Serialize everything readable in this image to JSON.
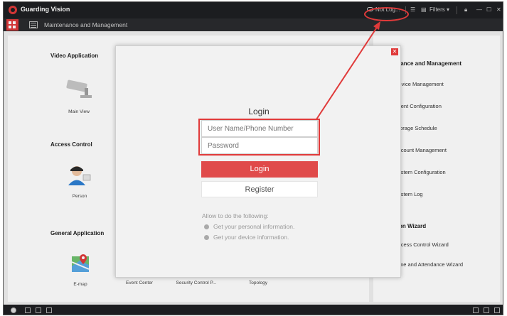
{
  "titlebar": {
    "app_title": "Guarding Vision",
    "login_status": "Not Log...",
    "filters": "Filters",
    "minimize_label": "—",
    "restore_label": "☐",
    "close_label": "✕"
  },
  "tabbar": {
    "tab_label": "Maintenance and Management"
  },
  "left_panel": {
    "sections": {
      "video": "Video Application",
      "access": "Access Control",
      "general": "General Application"
    },
    "modules": {
      "main_view": "Main View",
      "person": "Person",
      "emap": "E-map",
      "event_center": "Event Center",
      "security_control": "Security Control P...",
      "topology": "Topology"
    }
  },
  "right_panel": {
    "maint_title": "Maintenance and Management",
    "maint_items": [
      "Device Management",
      "Event Configuration",
      "Storage Schedule",
      "Account Management",
      "System Configuration",
      "System Log"
    ],
    "wizard_title": "Operation Wizard",
    "wizard_items": [
      "Access Control Wizard",
      "Time and Attendance Wizard"
    ]
  },
  "login_dialog": {
    "title": "Login",
    "username_placeholder": "User Name/Phone Number",
    "password_placeholder": "Password",
    "login_button": "Login",
    "register_button": "Register",
    "allow_text": "Allow to do the following:",
    "permissions": [
      "Get your personal information.",
      "Get your device information."
    ]
  },
  "colors": {
    "accent": "#e03a3a",
    "titlebar": "#1e1f22"
  },
  "icons": [
    "logo-icon",
    "cloud-icon",
    "list-icon",
    "monitor-icon",
    "lock-icon",
    "minimize-icon",
    "restore-icon",
    "close-icon",
    "camera-icon",
    "person-icon",
    "map-icon"
  ]
}
